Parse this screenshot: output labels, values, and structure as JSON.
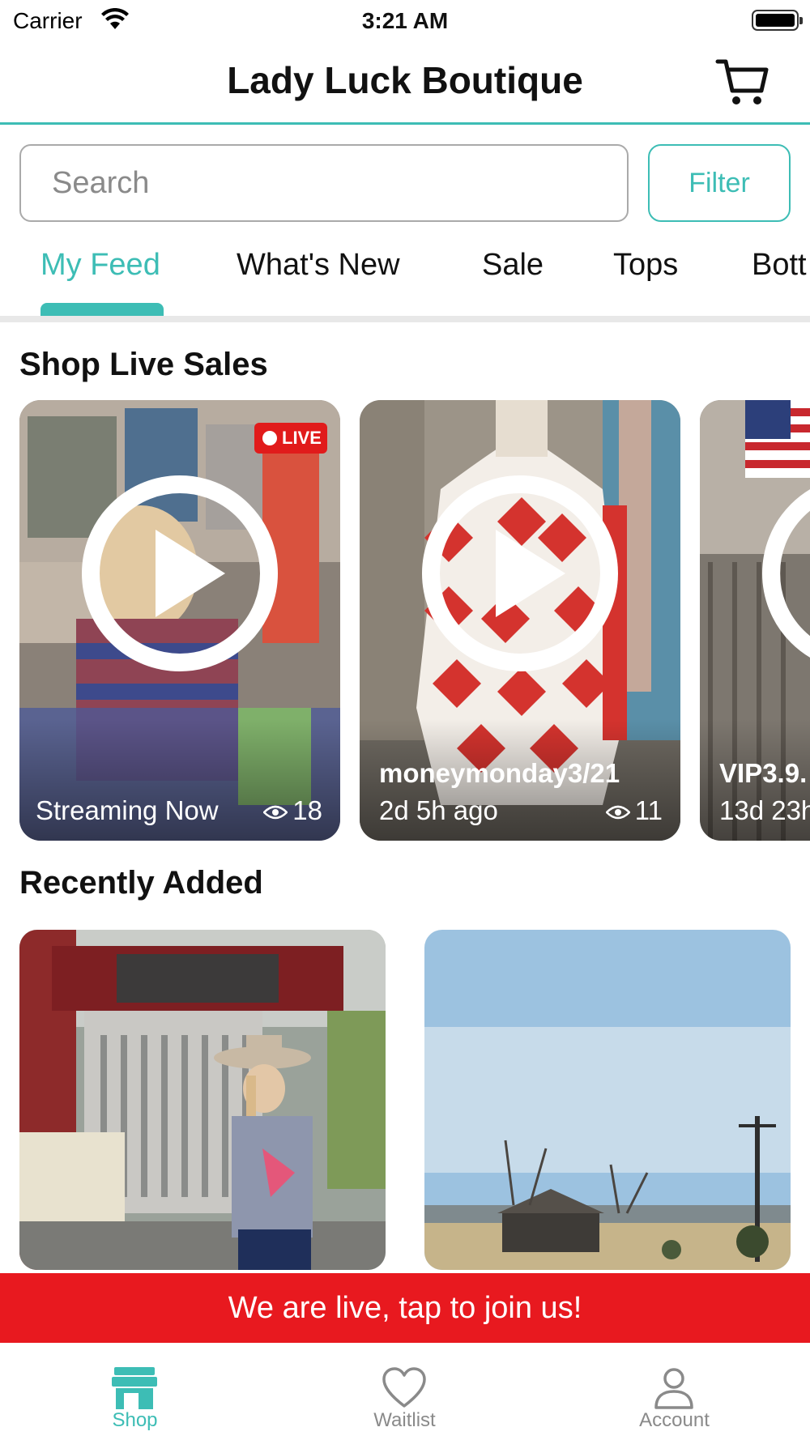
{
  "status_bar": {
    "carrier": "Carrier",
    "time": "3:21 AM"
  },
  "header": {
    "title": "Lady Luck Boutique"
  },
  "search": {
    "placeholder": "Search",
    "filter_label": "Filter"
  },
  "tabs": [
    {
      "label": "My Feed",
      "active": true
    },
    {
      "label": "What's New",
      "active": false
    },
    {
      "label": "Sale",
      "active": false
    },
    {
      "label": "Tops",
      "active": false
    },
    {
      "label": "Bott",
      "active": false
    }
  ],
  "live_sales": {
    "title": "Shop Live Sales",
    "cards": [
      {
        "name": "",
        "subtitle": "Streaming Now",
        "views": "18",
        "badge": "LIVE"
      },
      {
        "name": "moneymonday3/21",
        "subtitle": "2d 5h ago",
        "views": "11"
      },
      {
        "name": "VIP3.9.",
        "subtitle": "13d 23h"
      }
    ]
  },
  "recently_added": {
    "title": "Recently Added"
  },
  "live_banner": {
    "text": "We are live, tap to join us!"
  },
  "bottom_nav": [
    {
      "label": "Shop",
      "icon": "storefront-icon",
      "active": true
    },
    {
      "label": "Waitlist",
      "icon": "heart-icon",
      "active": false
    },
    {
      "label": "Account",
      "icon": "person-icon",
      "active": false
    }
  ],
  "colors": {
    "accent": "#3dbdb5",
    "live_red": "#e8191f",
    "inactive": "#8a8a8a"
  }
}
